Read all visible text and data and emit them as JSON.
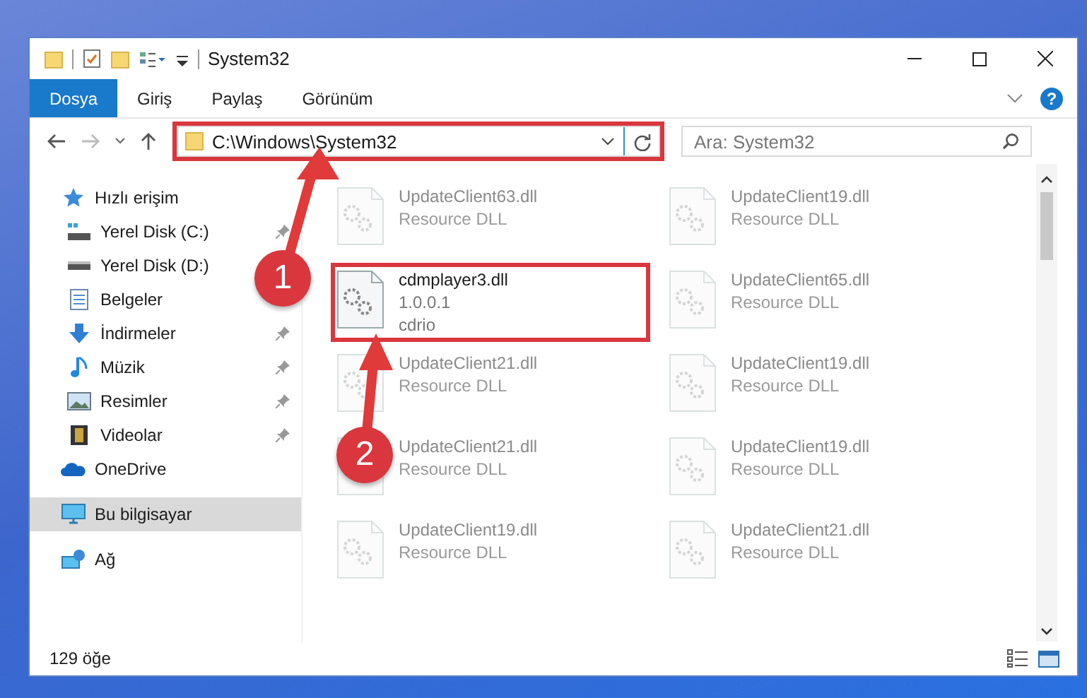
{
  "window": {
    "title": "System32"
  },
  "ribbon_tabs": [
    {
      "label": "Dosya",
      "selected": true
    },
    {
      "label": "Giriş",
      "selected": false
    },
    {
      "label": "Paylaş",
      "selected": false
    },
    {
      "label": "Görünüm",
      "selected": false
    }
  ],
  "help": "?",
  "address": {
    "value": "C:\\Windows\\System32"
  },
  "search": {
    "placeholder": "Ara: System32"
  },
  "sidebar": {
    "items": [
      {
        "label": "Hızlı erişim",
        "kind": "star",
        "selected": false,
        "children": [
          {
            "label": "Yerel Disk (C:)",
            "kind": "systemdrive",
            "pinned": true,
            "selected": false
          },
          {
            "label": "Yerel Disk (D:)",
            "kind": "drive",
            "pinned": false,
            "selected": false
          },
          {
            "label": "Belgeler",
            "kind": "document",
            "pinned": false,
            "selected": false
          },
          {
            "label": "İndirmeler",
            "kind": "download",
            "pinned": true,
            "selected": false
          },
          {
            "label": "Müzik",
            "kind": "music",
            "pinned": true,
            "selected": false
          },
          {
            "label": "Resimler",
            "kind": "picture",
            "pinned": true,
            "selected": false
          },
          {
            "label": "Videolar",
            "kind": "video",
            "pinned": true,
            "selected": false
          }
        ]
      },
      {
        "label": "OneDrive",
        "kind": "cloud",
        "selected": false
      },
      {
        "label": "Bu bilgisayar",
        "kind": "computer",
        "selected": true
      },
      {
        "label": "Ağ",
        "kind": "network",
        "selected": false
      }
    ]
  },
  "files": [
    {
      "name": "UpdateClient63.dll",
      "lines": [
        "Resource DLL"
      ],
      "blurred": true,
      "highlighted": false
    },
    {
      "name": "UpdateClient19.dll",
      "lines": [
        "Resource DLL"
      ],
      "blurred": true,
      "highlighted": false
    },
    {
      "name": "cdmplayer3.dll",
      "lines": [
        "1.0.0.1",
        "cdrio"
      ],
      "blurred": false,
      "highlighted": true
    },
    {
      "name": "UpdateClient65.dll",
      "lines": [
        "Resource DLL"
      ],
      "blurred": true,
      "highlighted": false
    },
    {
      "name": "UpdateClient21.dll",
      "lines": [
        "Resource DLL"
      ],
      "blurred": true,
      "highlighted": false
    },
    {
      "name": "UpdateClient19.dll",
      "lines": [
        "Resource DLL"
      ],
      "blurred": true,
      "highlighted": false
    },
    {
      "name": "UpdateClient21.dll",
      "lines": [
        "Resource DLL"
      ],
      "blurred": true,
      "highlighted": false
    },
    {
      "name": "UpdateClient19.dll",
      "lines": [
        "Resource DLL"
      ],
      "blurred": true,
      "highlighted": false
    },
    {
      "name": "UpdateClient19.dll",
      "lines": [
        "Resource DLL"
      ],
      "blurred": true,
      "highlighted": false
    },
    {
      "name": "UpdateClient21.dll",
      "lines": [
        "Resource DLL"
      ],
      "blurred": true,
      "highlighted": false
    }
  ],
  "status_bar": {
    "count": "129 öğe"
  },
  "annotations": [
    {
      "number": "1"
    },
    {
      "number": "2"
    }
  ]
}
